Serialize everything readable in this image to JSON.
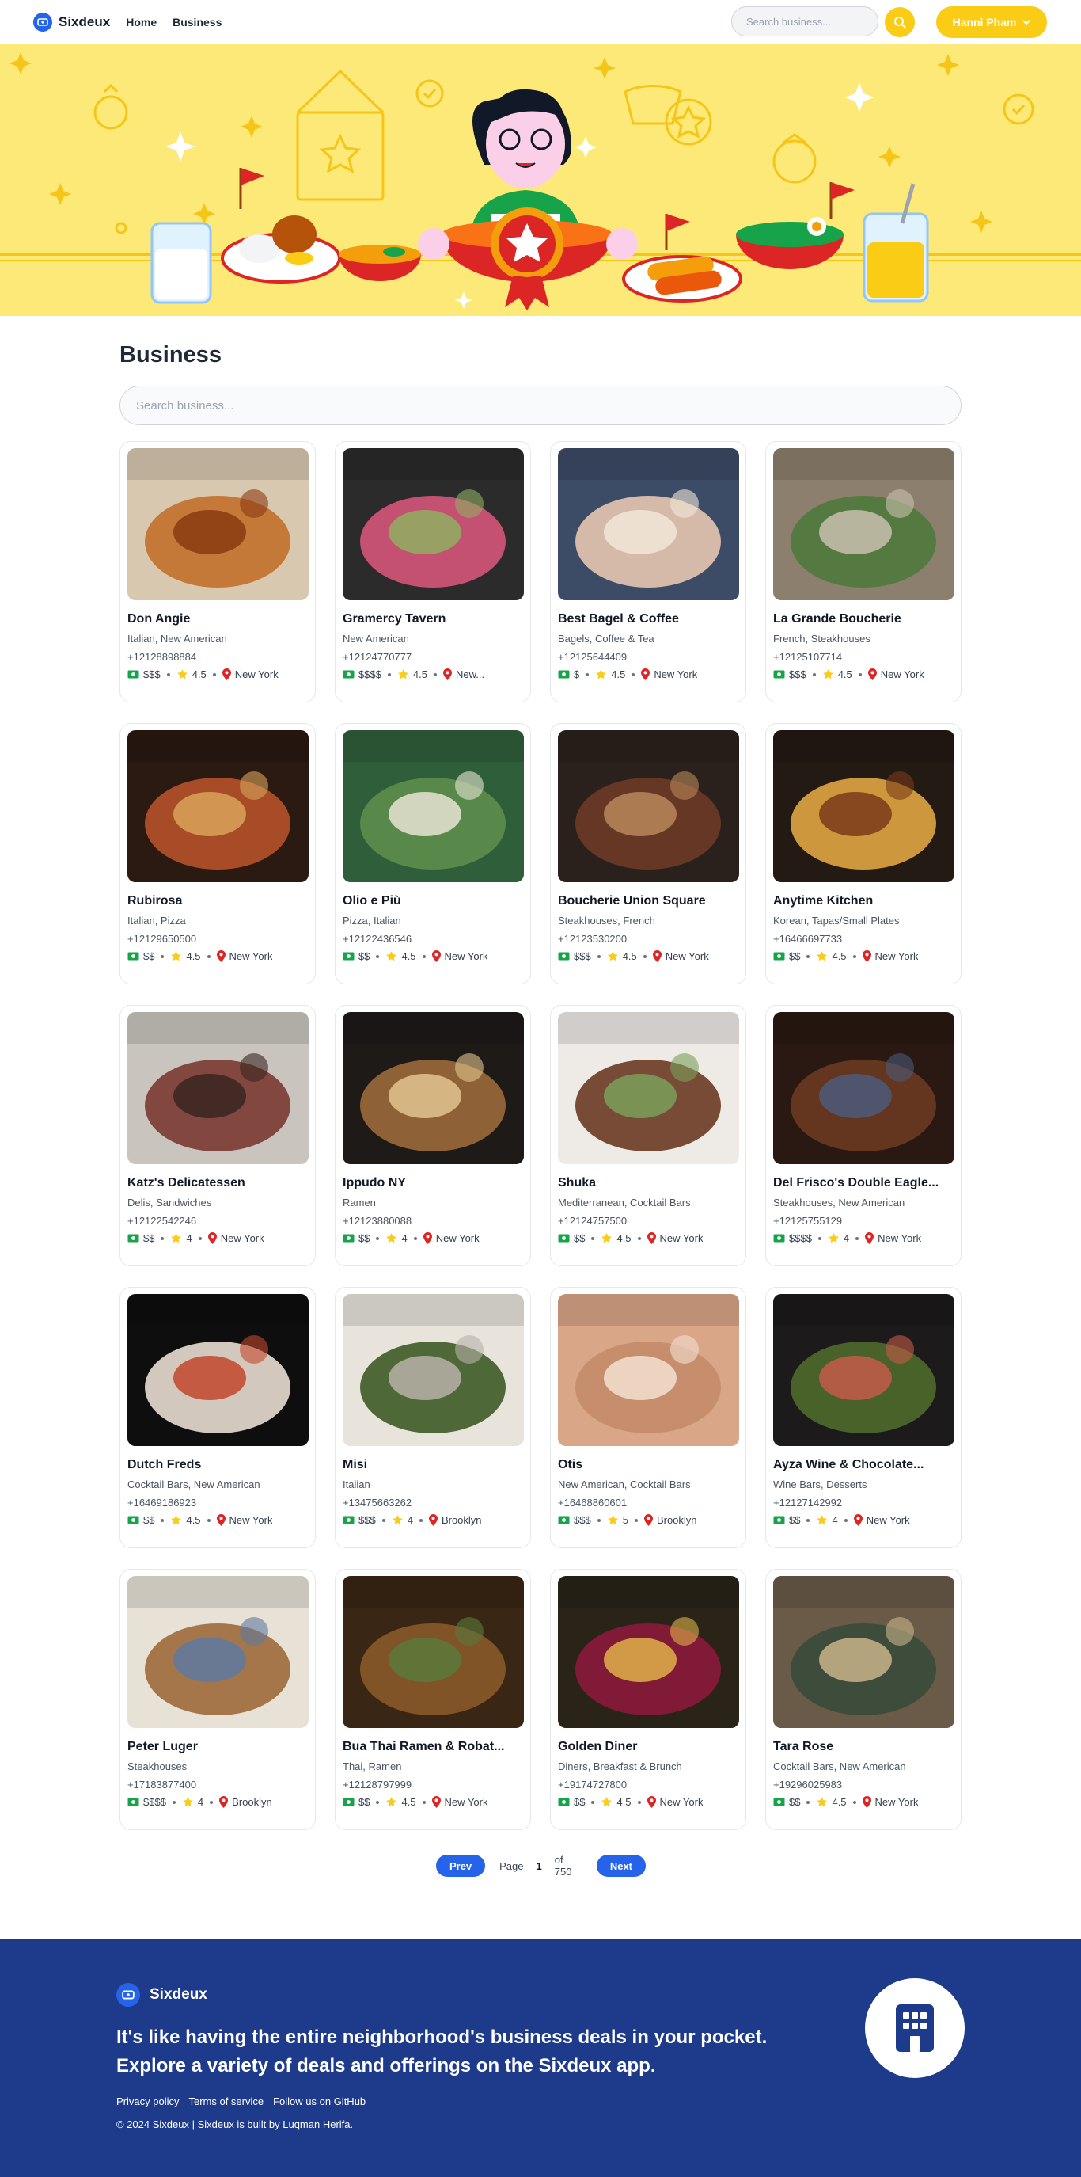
{
  "app": {
    "brand": "Sixdeux"
  },
  "nav": {
    "links": [
      "Home",
      "Business"
    ],
    "search_placeholder": "Search business...",
    "user_name": "Hanni Pham"
  },
  "colors": {
    "primary": "#2563eb",
    "accent": "#facc15",
    "hero_bg": "#fde977",
    "footer_bg": "#1e3a8a",
    "star": "#facc15",
    "pin": "#dc2626",
    "money": "#16a34a"
  },
  "main": {
    "title": "Business",
    "search_placeholder": "Search business..."
  },
  "businesses": [
    {
      "name": "Don Angie",
      "categories": "Italian, New American",
      "phone": "+12128898884",
      "price": "$$$",
      "rating": "4.5",
      "location": "New York",
      "photo": "pasta-rolls"
    },
    {
      "name": "Gramercy Tavern",
      "categories": "New American",
      "phone": "+12124770777",
      "price": "$$$$",
      "rating": "4.5",
      "location": "New...",
      "photo": "salad-plate"
    },
    {
      "name": "Best Bagel & Coffee",
      "categories": "Bagels, Coffee & Tea",
      "phone": "+12125644409",
      "price": "$",
      "rating": "4.5",
      "location": "New York",
      "photo": "bagel-hand"
    },
    {
      "name": "La Grande Boucherie",
      "categories": "French, Steakhouses",
      "phone": "+12125107714",
      "price": "$$$",
      "rating": "4.5",
      "location": "New York",
      "photo": "garden-courtyard"
    },
    {
      "name": "Rubirosa",
      "categories": "Italian, Pizza",
      "phone": "+12129650500",
      "price": "$$",
      "rating": "4.5",
      "location": "New York",
      "photo": "pizza"
    },
    {
      "name": "Olio e Più",
      "categories": "Pizza, Italian",
      "phone": "+12122436546",
      "price": "$$",
      "rating": "4.5",
      "location": "New York",
      "photo": "storefront"
    },
    {
      "name": "Boucherie Union Square",
      "categories": "Steakhouses, French",
      "phone": "+12123530200",
      "price": "$$$",
      "rating": "4.5",
      "location": "New York",
      "photo": "steak-sauce"
    },
    {
      "name": "Anytime Kitchen",
      "categories": "Korean, Tapas/Small Plates",
      "phone": "+16466697733",
      "price": "$$",
      "rating": "4.5",
      "location": "New York",
      "photo": "cheese-pan"
    },
    {
      "name": "Katz's Delicatessen",
      "categories": "Delis, Sandwiches",
      "phone": "+12122542246",
      "price": "$$",
      "rating": "4",
      "location": "New York",
      "photo": "pastrami"
    },
    {
      "name": "Ippudo NY",
      "categories": "Ramen",
      "phone": "+12123880088",
      "price": "$$",
      "rating": "4",
      "location": "New York",
      "photo": "dining-room"
    },
    {
      "name": "Shuka",
      "categories": "Mediterranean, Cocktail Bars",
      "phone": "+12124757500",
      "price": "$$",
      "rating": "4.5",
      "location": "New York",
      "photo": "meatballs"
    },
    {
      "name": "Del Frisco's Double Eagle...",
      "categories": "Steakhouses, New American",
      "phone": "+12125755129",
      "price": "$$$$",
      "rating": "4",
      "location": "New York",
      "photo": "restaurant-hall"
    },
    {
      "name": "Dutch Freds",
      "categories": "Cocktail Bars, New American",
      "phone": "+16469186923",
      "price": "$$",
      "rating": "4.5",
      "location": "New York",
      "photo": "sliders"
    },
    {
      "name": "Misi",
      "categories": "Italian",
      "phone": "+13475663262",
      "price": "$$$",
      "rating": "4",
      "location": "Brooklyn",
      "photo": "greens-bowl"
    },
    {
      "name": "Otis",
      "categories": "New American, Cocktail Bars",
      "phone": "+16468860601",
      "price": "$$$",
      "rating": "5",
      "location": "Brooklyn",
      "photo": "textured-plate"
    },
    {
      "name": "Ayza Wine & Chocolate...",
      "categories": "Wine Bars, Desserts",
      "phone": "+12127142992",
      "price": "$$",
      "rating": "4",
      "location": "New York",
      "photo": "patio"
    },
    {
      "name": "Peter Luger",
      "categories": "Steakhouses",
      "phone": "+17183877400",
      "price": "$$$$",
      "rating": "4",
      "location": "Brooklyn",
      "photo": "sauce-boat"
    },
    {
      "name": "Bua Thai Ramen & Robat...",
      "categories": "Thai, Ramen",
      "phone": "+12128797999",
      "price": "$$",
      "rating": "4.5",
      "location": "New York",
      "photo": "skewers"
    },
    {
      "name": "Golden Diner",
      "categories": "Diners, Breakfast & Brunch",
      "phone": "+19174727800",
      "price": "$$",
      "rating": "4.5",
      "location": "New York",
      "photo": "pancakes"
    },
    {
      "name": "Tara Rose",
      "categories": "Cocktail Bars, New American",
      "phone": "+19296025983",
      "price": "$$",
      "rating": "4.5",
      "location": "New York",
      "photo": "grain-bowl"
    }
  ],
  "pagination": {
    "prev": "Prev",
    "page_label": "Page",
    "current": "1",
    "of_label": "of 750",
    "next": "Next"
  },
  "footer": {
    "brand": "Sixdeux",
    "tagline": "It's like having the entire neighborhood's business deals in your pocket. Explore a variety of deals and offerings on the Sixdeux app.",
    "links": [
      "Privacy policy",
      "Terms of service",
      "Follow us on GitHub"
    ],
    "copyright": "© 2024 Sixdeux | Sixdeux is built by Luqman Herifa."
  }
}
